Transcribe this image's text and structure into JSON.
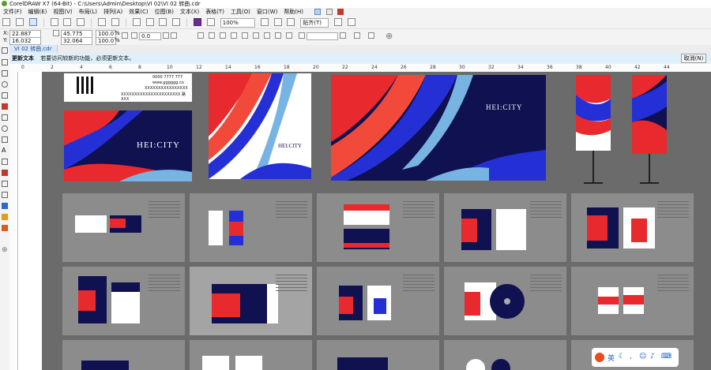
{
  "window": {
    "title": "CorelDRAW X7 (64-Bit) - C:\\Users\\Admin\\Desktop\\VI 02\\VI 02 转曲.cdr"
  },
  "menu": [
    "文件(F)",
    "编辑(E)",
    "视图(V)",
    "布局(L)",
    "排列(A)",
    "效果(C)",
    "位图(B)",
    "文本(X)",
    "表格(T)",
    "工具(O)",
    "窗口(W)",
    "帮助(H)"
  ],
  "toolbar": {
    "zoom": "100%",
    "snap": "贴齐(T)"
  },
  "properties": {
    "x_label": "X:",
    "x_value": "22.887 cm",
    "y_label": "Y:",
    "y_value": "16.032 cm",
    "w_value": "45.775 cm",
    "h_value": "32.064 cm",
    "scale_x": "100.0",
    "scale_y": "100.0",
    "pct": "%",
    "rotation": "0.0"
  },
  "document_tab": "VI 02 转曲.cdr",
  "notification": {
    "title": "更新文本",
    "message": "若要访问较新的功能，必须更新文本。",
    "cancel_label": "取消(N)"
  },
  "ruler_labels": [
    "0",
    "2",
    "4",
    "6",
    "8",
    "10",
    "12",
    "14",
    "16",
    "18",
    "20",
    "22",
    "24",
    "26",
    "28",
    "30",
    "32",
    "34",
    "36",
    "38",
    "40",
    "42",
    "44"
  ],
  "artwork": {
    "brand": "HEI:CITY",
    "card_phone": "0000 7777 777",
    "card_web": "www.gggggg.co",
    "card_addr": "XXXXXXXXXXXXXXXX",
    "card_addr2": "XXXXXXXXXXXXXXXXXXXXXX 路 XXX"
  },
  "colors": {
    "navy": "#0f1150",
    "red": "#e8292e",
    "blue": "#2430d6",
    "lightblue": "#78b4e3",
    "page_bg": "#6b6b6b",
    "tile_bg": "#8c8c8c"
  },
  "ime": {
    "lang": "英"
  }
}
